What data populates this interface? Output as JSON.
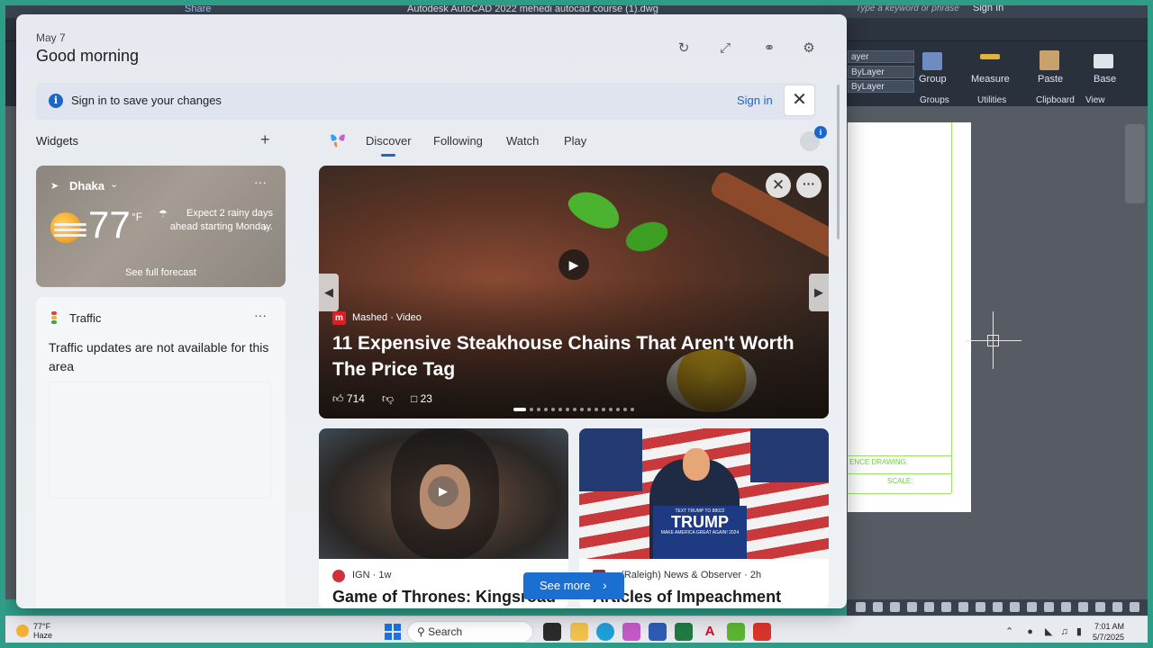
{
  "autocad": {
    "window_title": "Autodesk AutoCAD 2022   mehedi autocad course (1).dwg",
    "share_label": "Share",
    "search_placeholder": "Type a keyword or phrase",
    "signin_label": "Sign In",
    "layer_fields": [
      "ayer",
      "ByLayer",
      "ByLayer"
    ],
    "ribbon": {
      "group": "Group",
      "measure": "Measure",
      "paste": "Paste",
      "base": "Base",
      "groups_panel": "Groups",
      "utilities_panel": "Utilities",
      "clipboard_panel": "Clipboard",
      "view_panel": "View"
    },
    "titleblock": {
      "reference": "ENCE DRAWING:",
      "scale": "SCALE:"
    }
  },
  "widgets": {
    "date": "May 7",
    "greeting": "Good morning",
    "header_icons": [
      "refresh-icon",
      "expand-icon",
      "link-icon",
      "gear-icon"
    ],
    "signin_bar": {
      "message": "Sign in to save your changes",
      "link": "Sign in"
    },
    "section_title": "Widgets",
    "weather": {
      "location": "Dhaka",
      "temperature": "77",
      "unit": "°F",
      "forecast": "Expect 2 rainy days ahead starting Monday.",
      "link": "See full forecast"
    },
    "traffic": {
      "title": "Traffic",
      "message": "Traffic updates are not available for this area"
    }
  },
  "feed": {
    "tabs": [
      "Discover",
      "Following",
      "Watch",
      "Play"
    ],
    "active_tab": "Discover",
    "hero": {
      "source": "Mashed · Video",
      "headline": "11 Expensive Steakhouse Chains That Aren't Worth The Price Tag",
      "likes": "714",
      "comments": "23"
    },
    "cards": [
      {
        "source": "IGN · 1w",
        "headline": "Game of Thrones: Kingsroad"
      },
      {
        "source": "e (Raleigh) News & Observer · 2h",
        "headline": "Articles of Impeachment",
        "podium_top": "TEXT TRUMP TO 88022",
        "podium_name": "TRUMP",
        "podium_bottom": "MAKE AMERICA GREAT AGAIN! 2024"
      }
    ],
    "see_more": "See more"
  },
  "taskbar": {
    "weather_temp": "77°F",
    "weather_cond": "Haze",
    "search_label": "Search",
    "time": "7:01 AM",
    "date": "5/7/2025"
  },
  "colors": {
    "accent": "#1a66c9",
    "frame": "#2e9c86",
    "see_more_bg": "#1a6fd1"
  }
}
